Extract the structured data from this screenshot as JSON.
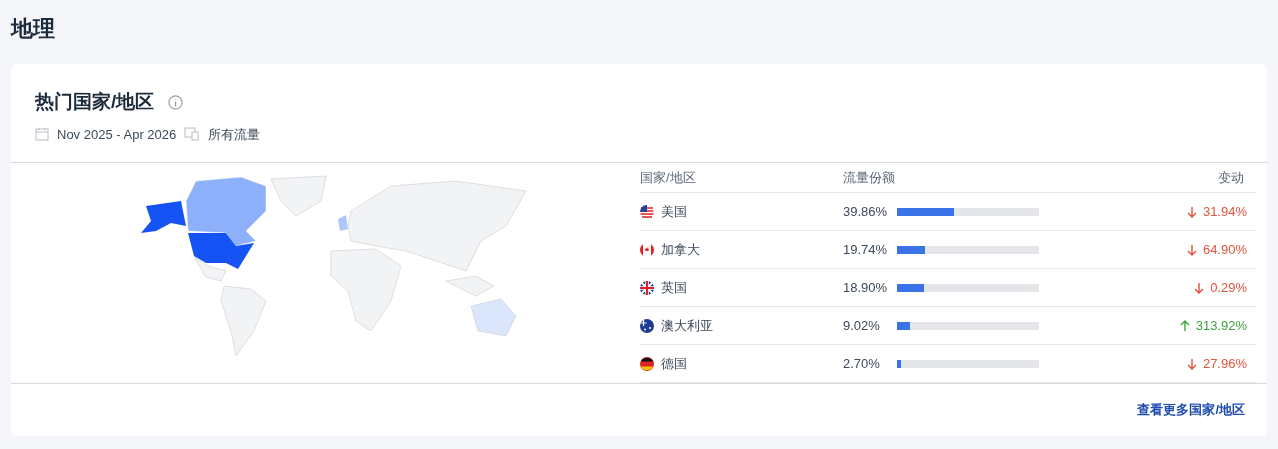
{
  "page_title": "地理",
  "card": {
    "title": "热门国家/地区",
    "date_range": "Nov 2025 - Apr 2026",
    "traffic_type": "所有流量",
    "table": {
      "columns": [
        "国家/地区",
        "流量份额",
        "变动"
      ],
      "rows": [
        {
          "country": "美国",
          "share": "39.86%",
          "level": 0.3986,
          "change": "31.94%",
          "kind": "down"
        },
        {
          "country": "加拿大",
          "share": "19.74%",
          "level": 0.1974,
          "change": "64.90%",
          "kind": "down"
        },
        {
          "country": "英国",
          "share": "18.90%",
          "level": 0.189,
          "change": "0.29%",
          "kind": "down"
        },
        {
          "country": "澳大利亚",
          "share": "9.02%",
          "level": 0.0902,
          "change": "313.92%",
          "kind": "up"
        },
        {
          "country": "德国",
          "share": "2.70%",
          "level": 0.027,
          "change": "27.96%",
          "kind": "down"
        }
      ]
    },
    "more_link": "查看更多国家/地区"
  }
}
